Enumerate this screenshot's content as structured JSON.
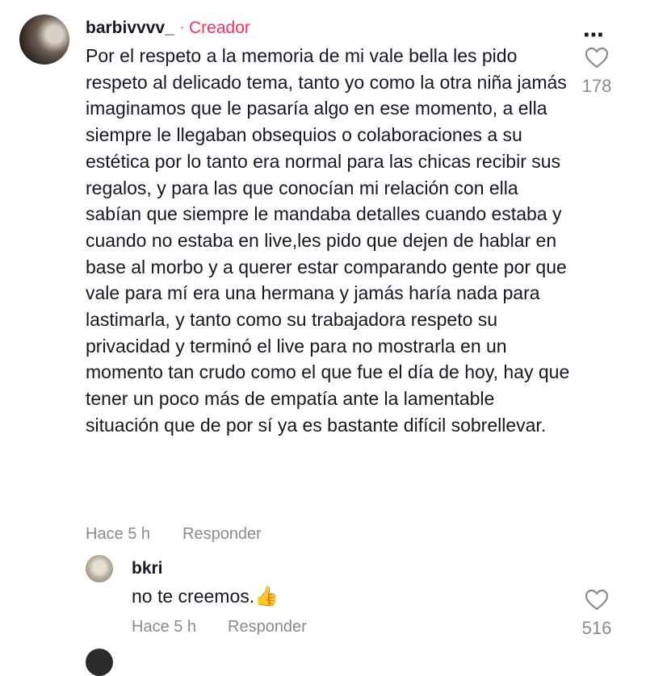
{
  "comment": {
    "username": "barbivvvv_",
    "separator": "·",
    "creator_badge": "Creador",
    "text": "Por el respeto a la memoria de mi vale bella les pido respeto al delicado tema, tanto yo como la otra niña jamás imaginamos que le pasaría algo en ese momento, a ella siempre le llegaban obsequios o colaboraciones a su estética por lo tanto era normal para las chicas recibir sus regalos, y para las que conocían mi relación con ella sabían que siempre le mandaba detalles cuando estaba y cuando no estaba en live,les pido que dejen de hablar en base al morbo y a querer estar comparando gente por que vale para mí era una hermana y jamás haría nada para lastimarla, y tanto como su trabajadora respeto su privacidad y terminó el live para no mostrarla en un momento tan crudo como el que fue el día de hoy, hay que tener un poco más de empatía ante la lamentable situación que de por sí ya es bastante difícil sobrellevar.",
    "time": "Hace 5 h",
    "reply_label": "Responder",
    "likes": "178",
    "more_icon": "⋯"
  },
  "reply": {
    "username": "bkri",
    "text": "no te creemos.",
    "emoji": "👍",
    "time": "Hace 5 h",
    "reply_label": "Responder",
    "likes": "516"
  },
  "colors": {
    "creator": "#fe2c55",
    "muted": "#8a8b91",
    "text": "#161823"
  }
}
